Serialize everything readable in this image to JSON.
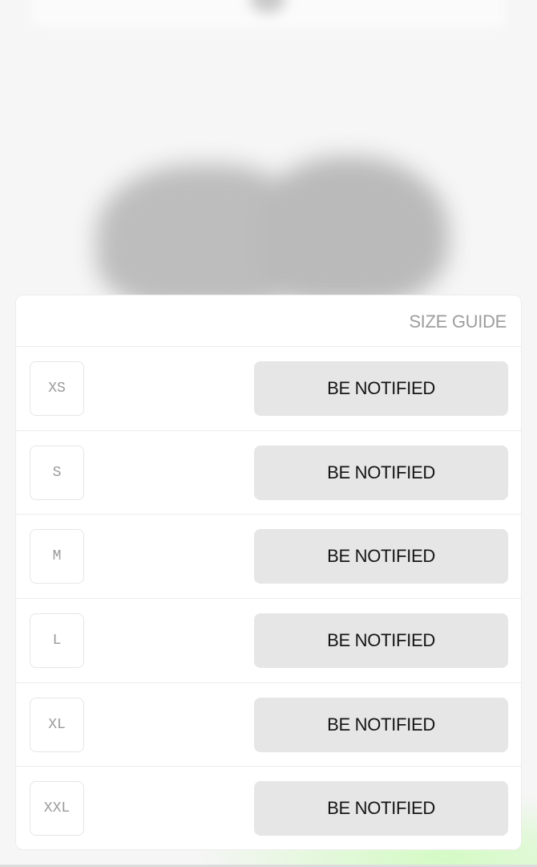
{
  "sheet": {
    "size_guide_label": "SIZE GUIDE",
    "sizes": [
      {
        "label": "XS",
        "action_label": "BE NOTIFIED"
      },
      {
        "label": "S",
        "action_label": "BE NOTIFIED"
      },
      {
        "label": "M",
        "action_label": "BE NOTIFIED"
      },
      {
        "label": "L",
        "action_label": "BE NOTIFIED"
      },
      {
        "label": "XL",
        "action_label": "BE NOTIFIED"
      },
      {
        "label": "XXL",
        "action_label": "BE NOTIFIED"
      }
    ]
  },
  "colors": {
    "background": "#f6f6f6",
    "button_fill": "#e6e6e6",
    "muted_text": "#9d9d9d",
    "accent_glow": "#b4ff96"
  }
}
